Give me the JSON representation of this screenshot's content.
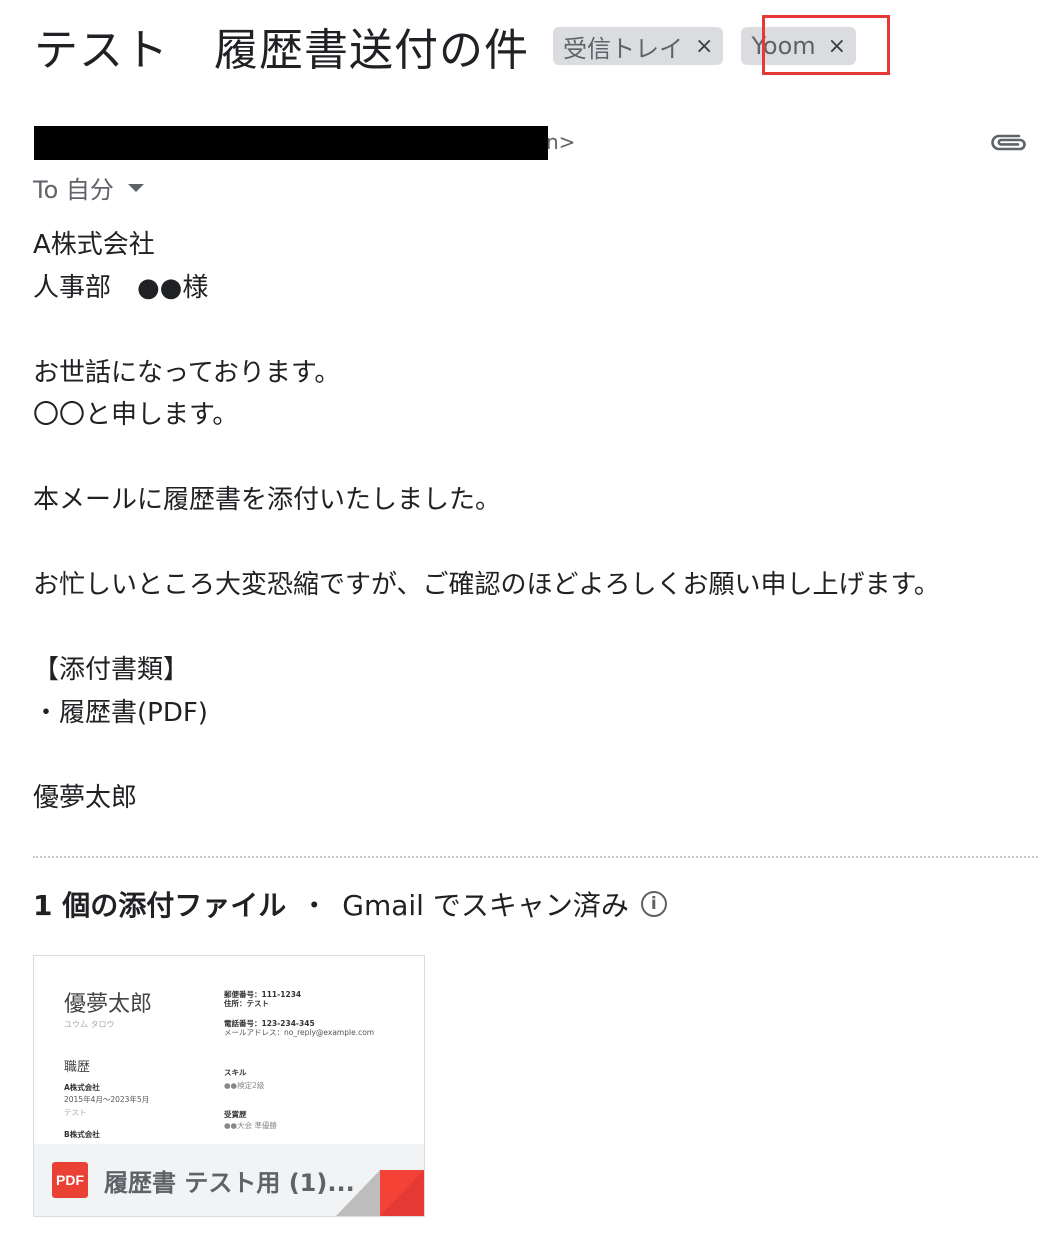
{
  "subject": "テスト　履歴書送付の件",
  "labels": [
    {
      "name": "受信トレイ",
      "close": "×"
    },
    {
      "name": "Yoom",
      "close": "×"
    }
  ],
  "sender": {
    "visible_tail": "n>"
  },
  "recipient": {
    "to": "To 自分"
  },
  "body_text": "A株式会社\n人事部　●●様\n\nお世話になっております。\n〇〇と申します。\n\n本メールに履歴書を添付いたしました。\n\nお忙しいところ大変恐縮ですが、ご確認のほどよろしくお願い申し上げます。\n\n【添付書類】\n・履歴書(PDF)\n\n優夢太郎",
  "attachments": {
    "count_label": "1 個の添付ファイル",
    "separator": "・",
    "scan_status": "Gmail でスキャン済み",
    "info_glyph": "i",
    "files": [
      {
        "type_badge": "PDF",
        "name": "履歴書 テスト用 (1)...",
        "preview": {
          "name": "優夢太郎",
          "kana": "ユウム タロウ",
          "postal": "郵便番号：111-1234",
          "address": "住所：テスト",
          "phone": "電話番号：123-234-345",
          "email": "メールアドレス：no_reply@example.com",
          "career_heading": "職歴",
          "company1": "A株式会社",
          "period1": "2015年4月〜2023年5月",
          "desc1": "テスト",
          "company2": "B株式会社",
          "skills_heading": "スキル",
          "skill1": "●●検定2級",
          "awards_heading": "受賞歴",
          "award1": "●●大会 準優勝"
        }
      }
    ]
  },
  "colors": {
    "highlight_border": "#e53935",
    "pdf_badge": "#e94235",
    "chip_bg": "#dadce0"
  }
}
